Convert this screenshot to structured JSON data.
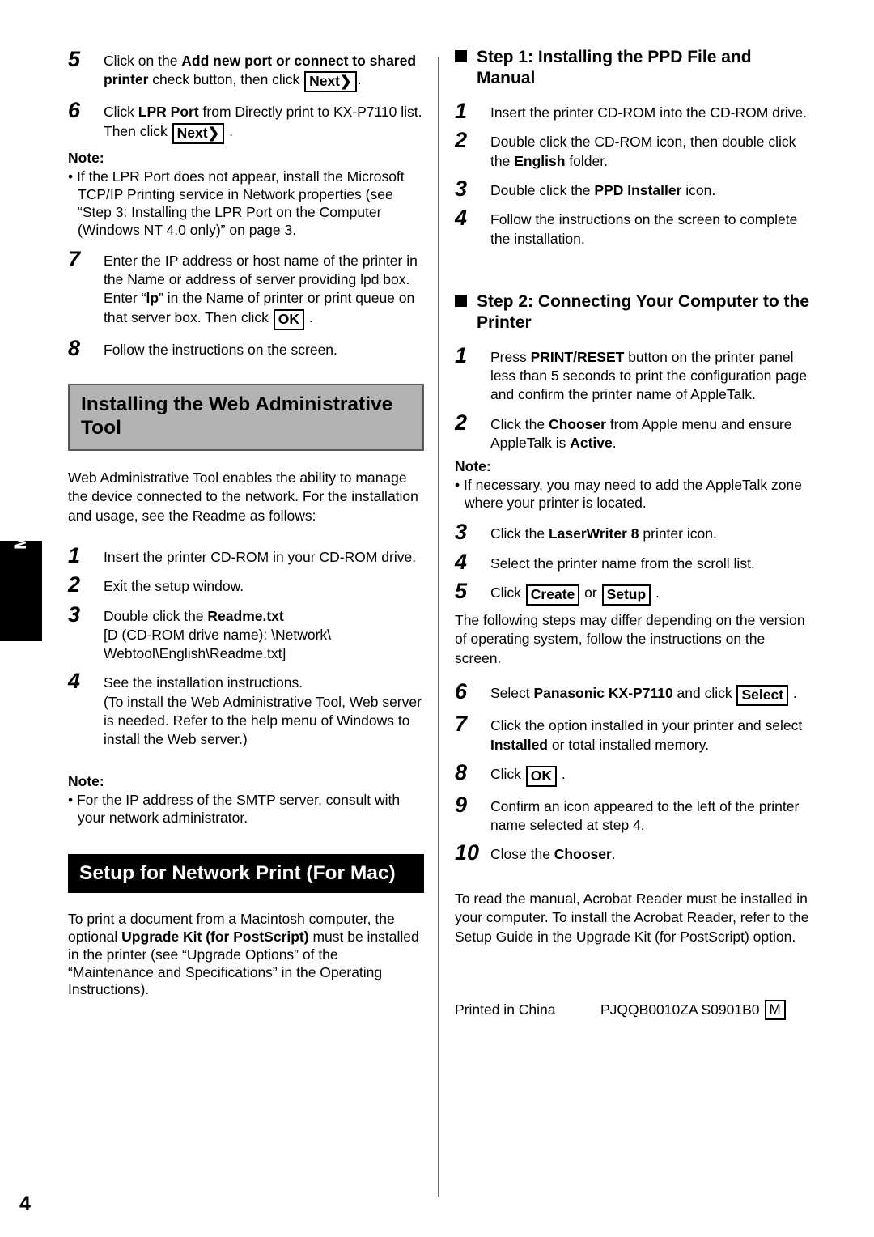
{
  "page": {
    "number": "4",
    "side_tab_label": "Mac"
  },
  "left_column": {
    "steps_continued": [
      {
        "num": "5",
        "segments": [
          {
            "t": "Click on the ",
            "b": false
          },
          {
            "t": "Add new port or connect to shared printer",
            "b": true
          },
          {
            "t": " check button, then click ",
            "b": false
          },
          {
            "t": "Next",
            "btn": true,
            "chev": true
          },
          {
            "t": ".",
            "b": false
          }
        ]
      },
      {
        "num": "6",
        "segments": [
          {
            "t": "Click ",
            "b": false
          },
          {
            "t": "LPR Port",
            "b": true
          },
          {
            "t": " from Directly print to KX-P7110 list. Then click ",
            "b": false
          },
          {
            "t": "Next",
            "btn": true,
            "chev": true
          },
          {
            "t": " .",
            "b": false
          }
        ]
      }
    ],
    "note_1": {
      "title": "Note:",
      "body": "• If the LPR Port does not appear, install the Microsoft TCP/IP Printing service in Network properties (see “Step 3: Installing the LPR Port on the Computer (Windows NT 4.0 only)” on page 3."
    },
    "steps_after_note": [
      {
        "num": "7",
        "segments": [
          {
            "t": "Enter the IP address or host name of the printer in the Name or address of server providing lpd box. Enter “",
            "b": false
          },
          {
            "t": "lp",
            "b": true
          },
          {
            "t": "” in the Name of printer or print queue on that server box. Then click ",
            "b": false
          },
          {
            "t": "OK",
            "btn": true,
            "chev": false
          },
          {
            "t": " .",
            "b": false
          }
        ]
      },
      {
        "num": "8",
        "segments": [
          {
            "t": "Follow the instructions on the screen.",
            "b": false
          }
        ]
      }
    ],
    "heading_webtool": "Installing the Web Administrative Tool",
    "webtool_intro": "Web Administrative Tool enables the ability to manage the device connected to the network. For the installation and usage, see the Readme as follows:",
    "webtool_steps": [
      {
        "num": "1",
        "segments": [
          {
            "t": "Insert the printer CD-ROM in your CD-ROM drive.",
            "b": false
          }
        ]
      },
      {
        "num": "2",
        "segments": [
          {
            "t": "Exit the setup window.",
            "b": false
          }
        ]
      },
      {
        "num": "3",
        "segments": [
          {
            "t": "Double click the ",
            "b": false
          },
          {
            "t": "Readme.txt",
            "b": true
          },
          {
            "t": "\n[D (CD-ROM drive name): \\Network\\ Webtool\\English\\Readme.txt]",
            "b": false
          }
        ]
      },
      {
        "num": "4",
        "segments": [
          {
            "t": "See the installation instructions.\n(To install the Web Administrative Tool, Web server is needed. Refer to the help menu of Windows to install the Web server.)",
            "b": false
          }
        ]
      }
    ],
    "note_2": {
      "title": "Note:",
      "body": "• For the IP address of the SMTP server, consult with your network administrator."
    },
    "heading_setup_mac": "Setup for Network Print (For Mac)",
    "setup_mac_intro_segments": [
      {
        "t": "To print a document from a Macintosh computer, the optional ",
        "b": false
      },
      {
        "t": "Upgrade Kit (for PostScript)",
        "b": true
      },
      {
        "t": " must be installed in the printer (see “Upgrade Options” of the “Maintenance and Specifications” in the Operating Instructions).",
        "b": false
      }
    ]
  },
  "right_column": {
    "step1_heading": "Step 1: Installing the PPD File and Manual",
    "step1_items": [
      {
        "num": "1",
        "segments": [
          {
            "t": "Insert the printer CD-ROM into the CD-ROM drive.",
            "b": false
          }
        ]
      },
      {
        "num": "2",
        "segments": [
          {
            "t": "Double click the CD-ROM icon, then double click the ",
            "b": false
          },
          {
            "t": "English",
            "b": true
          },
          {
            "t": " folder.",
            "b": false
          }
        ]
      },
      {
        "num": "3",
        "segments": [
          {
            "t": "Double click the ",
            "b": false
          },
          {
            "t": "PPD Installer",
            "b": true
          },
          {
            "t": " icon.",
            "b": false
          }
        ]
      },
      {
        "num": "4",
        "segments": [
          {
            "t": "Follow the instructions on the screen to complete the installation.",
            "b": false
          }
        ]
      }
    ],
    "step2_heading": "Step 2: Connecting Your Computer to the Printer",
    "step2_items_a": [
      {
        "num": "1",
        "segments": [
          {
            "t": "Press ",
            "b": false
          },
          {
            "t": "PRINT/RESET",
            "b": true
          },
          {
            "t": " button on the printer panel less than 5 seconds to print the configuration page and confirm the printer name of AppleTalk.",
            "b": false
          }
        ]
      },
      {
        "num": "2",
        "segments": [
          {
            "t": "Click the ",
            "b": false
          },
          {
            "t": "Chooser",
            "b": true
          },
          {
            "t": " from Apple menu and ensure AppleTalk is ",
            "b": false
          },
          {
            "t": "Active",
            "b": true
          },
          {
            "t": ".",
            "b": false
          }
        ]
      }
    ],
    "note": {
      "title": "Note:",
      "body": "• If necessary, you may need to add the AppleTalk zone where your printer is located."
    },
    "step2_items_b": [
      {
        "num": "3",
        "segments": [
          {
            "t": "Click the ",
            "b": false
          },
          {
            "t": "LaserWriter 8",
            "b": true
          },
          {
            "t": " printer icon.",
            "b": false
          }
        ]
      },
      {
        "num": "4",
        "segments": [
          {
            "t": "Select the printer name from the scroll list.",
            "b": false
          }
        ]
      },
      {
        "num": "5",
        "segments": [
          {
            "t": "Click ",
            "b": false
          },
          {
            "t": "Create",
            "btn": true,
            "chev": false
          },
          {
            "t": " or ",
            "b": false
          },
          {
            "t": "Setup",
            "btn": true,
            "chev": false
          },
          {
            "t": " .",
            "b": false
          }
        ]
      }
    ],
    "mid_note": "The following steps may differ depending on the version of operating system, follow the instructions on the screen.",
    "step2_items_c": [
      {
        "num": "6",
        "segments": [
          {
            "t": "Select ",
            "b": false
          },
          {
            "t": "Panasonic KX-P7110",
            "b": true
          },
          {
            "t": " and click ",
            "b": false
          },
          {
            "t": "Select",
            "btn": true,
            "chev": false
          },
          {
            "t": " .",
            "b": false
          }
        ]
      },
      {
        "num": "7",
        "segments": [
          {
            "t": "Click the option installed in your printer and select ",
            "b": false
          },
          {
            "t": "Installed",
            "b": true
          },
          {
            "t": " or total installed memory.",
            "b": false
          }
        ]
      },
      {
        "num": "8",
        "segments": [
          {
            "t": "Click ",
            "b": false
          },
          {
            "t": "OK",
            "btn": true,
            "chev": false
          },
          {
            "t": " .",
            "b": false
          }
        ]
      },
      {
        "num": "9",
        "segments": [
          {
            "t": "Confirm an icon appeared to the left of the printer name selected at step 4.",
            "b": false
          }
        ]
      },
      {
        "num": "10",
        "segments": [
          {
            "t": "Close the ",
            "b": false
          },
          {
            "t": "Chooser",
            "b": true
          },
          {
            "t": ".",
            "b": false
          }
        ]
      }
    ],
    "acrobat_note": "To read the manual, Acrobat Reader must be installed in your computer. To install the Acrobat Reader, refer to the Setup Guide in the Upgrade Kit (for PostScript) option.",
    "footer": {
      "printed_in": "Printed in China",
      "part_number": "PJQQB0010ZA  S0901B0",
      "mark": "M"
    }
  }
}
